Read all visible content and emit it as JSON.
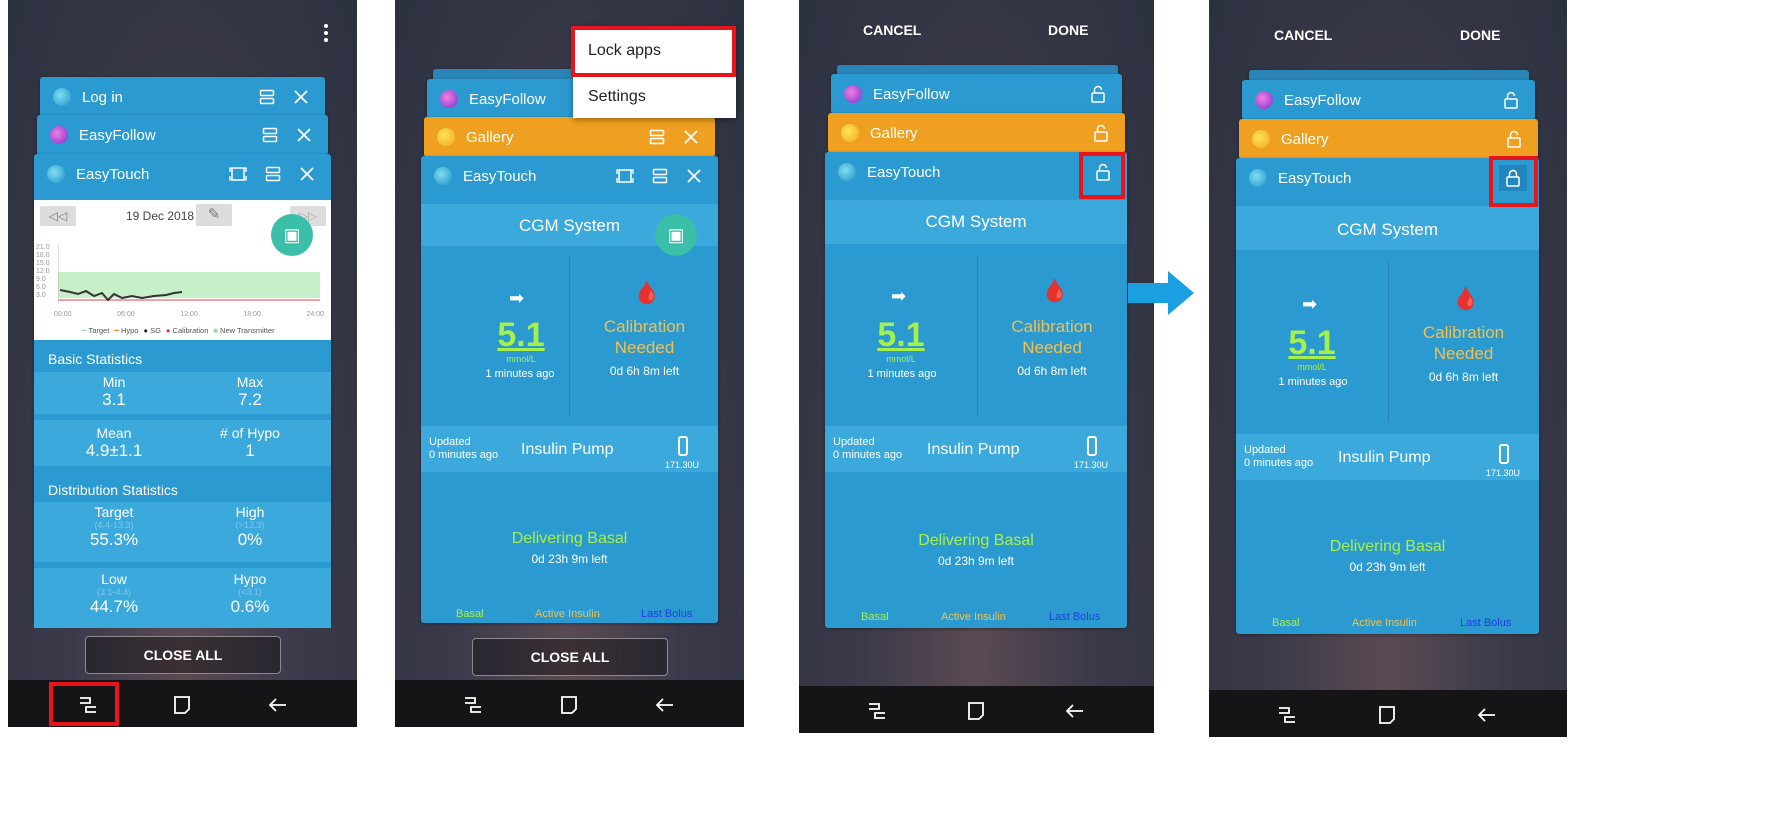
{
  "panel1": {
    "cards": [
      {
        "title": "Log in"
      },
      {
        "title": "EasyFollow"
      },
      {
        "title": "EasyTouch"
      }
    ],
    "chart": {
      "date": "19 Dec 2018",
      "y_ticks": [
        "21.0",
        "18.0",
        "15.0",
        "12.0",
        "9.0",
        "6.0",
        "3.0"
      ],
      "x_ticks": [
        "00:00",
        "06:00",
        "12:00",
        "18:00",
        "24:00"
      ],
      "legend": [
        "Target",
        "Hypo",
        "SG",
        "Calibration",
        "New Transmitter"
      ]
    },
    "basic": {
      "heading": "Basic Statistics",
      "min_label": "Min",
      "min_value": "3.1",
      "max_label": "Max",
      "max_value": "7.2",
      "mean_label": "Mean",
      "mean_value": "4.9±1.1",
      "hypo_label": "# of Hypo",
      "hypo_value": "1"
    },
    "dist": {
      "heading": "Distribution Statistics",
      "target_label": "Target",
      "target_range": "(4.4-13.3)",
      "target_value": "55.3%",
      "high_label": "High",
      "high_range": "(>13.3)",
      "high_value": "0%",
      "low_label": "Low",
      "low_range": "(3.1-4.4)",
      "low_value": "44.7%",
      "hypo_label": "Hypo",
      "hypo_range": "(<3.1)",
      "hypo_value": "0.6%"
    },
    "close_all": "CLOSE ALL"
  },
  "panel2": {
    "cards": [
      {
        "title": "EasyFollow"
      },
      {
        "title": "Gallery"
      },
      {
        "title": "EasyTouch"
      }
    ],
    "menu": [
      "Lock apps",
      "Settings"
    ],
    "close_all": "CLOSE ALL"
  },
  "panel3": {
    "cancel": "CANCEL",
    "done": "DONE",
    "cards": [
      {
        "title": "EasyFollow"
      },
      {
        "title": "Gallery"
      },
      {
        "title": "EasyTouch"
      }
    ]
  },
  "panel4": {
    "cancel": "CANCEL",
    "done": "DONE",
    "cards": [
      {
        "title": "EasyFollow"
      },
      {
        "title": "Gallery"
      },
      {
        "title": "EasyTouch"
      }
    ]
  },
  "cgm": {
    "heading": "CGM System",
    "glucose": "5.1",
    "unit": "mmol/L",
    "ago": "1 minutes ago",
    "calib_line1": "Calibration",
    "calib_line2": "Needed",
    "calib_left": "0d 6h 8m left",
    "updated_line1": "Updated",
    "updated_line2": "0 minutes ago",
    "pump": "Insulin Pump",
    "pump_units": "171.30U",
    "delivering": "Delivering Basal",
    "delivering_left": "0d 23h 9m left",
    "tab_basal": "Basal",
    "tab_active": "Active Insulin",
    "tab_bolus": "Last Bolus"
  },
  "colors": {
    "card_blue": "#2a9ad0",
    "card_orange": "#f0a020",
    "highlight_red": "#e8141c",
    "arrow_blue": "#1aa0e0"
  },
  "icons": [
    "more-vert-icon",
    "recents-icon",
    "home-icon",
    "back-icon",
    "split-screen-icon",
    "close-icon",
    "lock-open-icon",
    "blood-drop-icon",
    "arrow-right-icon",
    "pump-icon",
    "edit-icon",
    "report-icon"
  ]
}
